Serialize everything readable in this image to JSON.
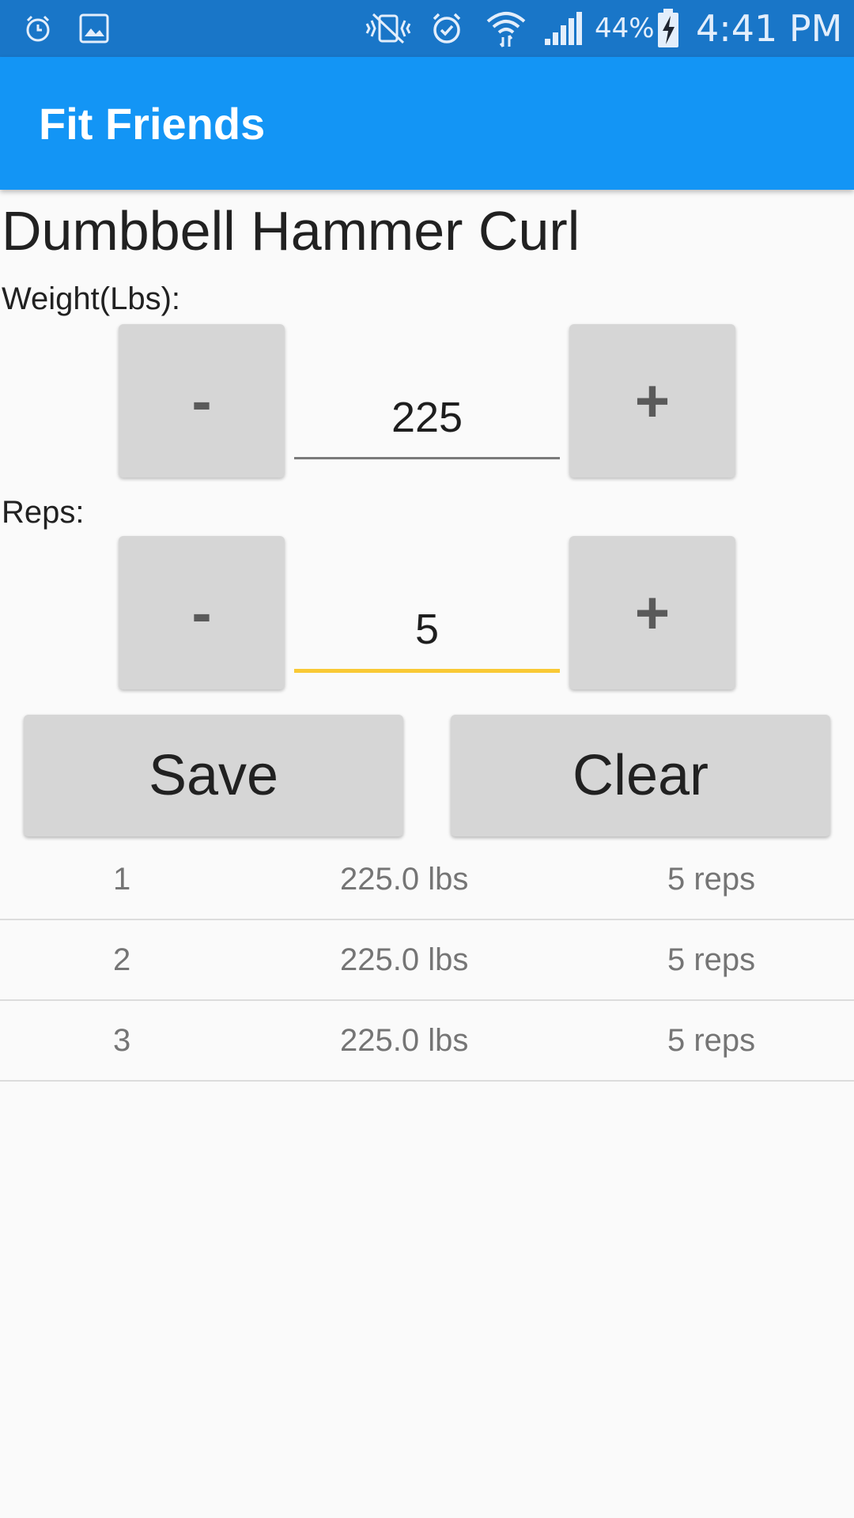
{
  "status_bar": {
    "battery": "44%",
    "time": "4:41 PM",
    "left_icons": [
      "alarm-icon",
      "image-icon"
    ],
    "right_icons": [
      "vibrate-icon",
      "alarm-icon",
      "wifi-icon",
      "signal-icon",
      "battery-charging-icon"
    ]
  },
  "app_bar": {
    "title": "Fit Friends"
  },
  "exercise": {
    "title": "Dumbbell Hammer Curl"
  },
  "weight": {
    "label": "Weight(Lbs):",
    "decrement_label": "-",
    "increment_label": "+",
    "value": "225"
  },
  "reps": {
    "label": "Reps:",
    "decrement_label": "-",
    "increment_label": "+",
    "value": "5"
  },
  "actions": {
    "save_label": "Save",
    "clear_label": "Clear"
  },
  "log": [
    {
      "set": "1",
      "weight": "225.0 lbs",
      "reps": "5 reps"
    },
    {
      "set": "2",
      "weight": "225.0 lbs",
      "reps": "5 reps"
    },
    {
      "set": "3",
      "weight": "225.0 lbs",
      "reps": "5 reps"
    }
  ],
  "colors": {
    "status_bar": "#1976c8",
    "app_bar": "#1395f5",
    "focused_underline": "#f9c935",
    "button_bg": "#d6d6d6"
  }
}
